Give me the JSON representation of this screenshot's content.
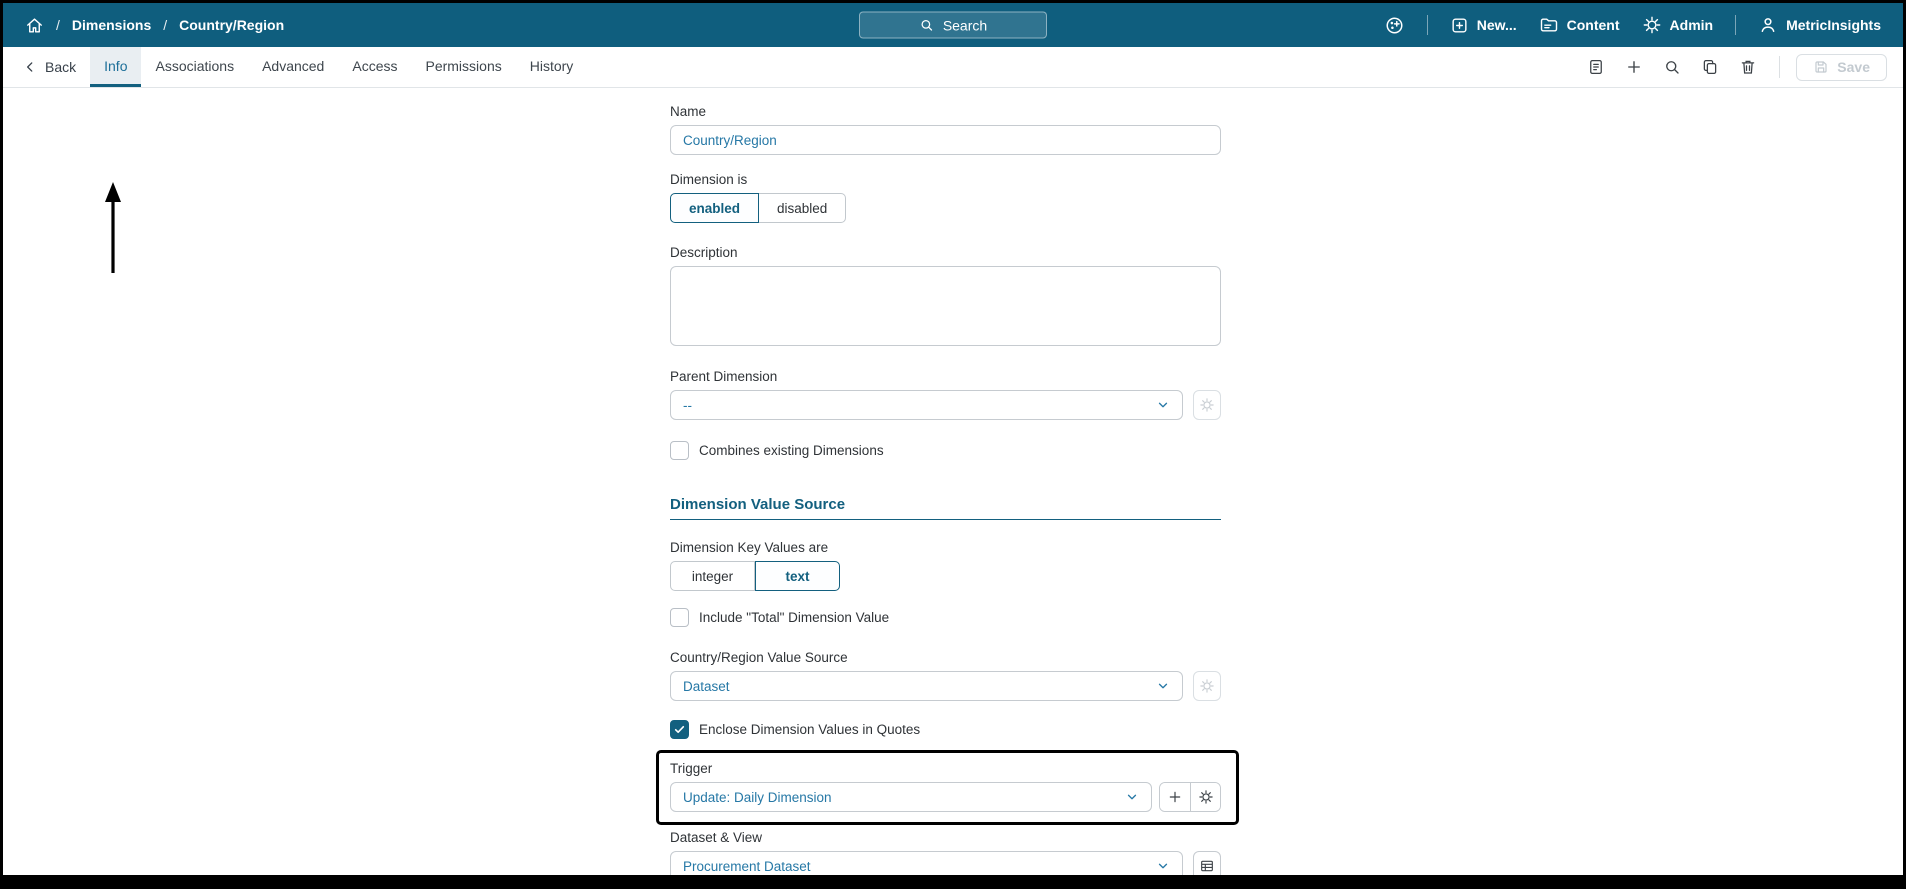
{
  "header": {
    "breadcrumb": {
      "separator": "/",
      "items": [
        "Dimensions",
        "Country/Region"
      ]
    },
    "search_placeholder": "Search",
    "nav": {
      "new_label": "New...",
      "content_label": "Content",
      "admin_label": "Admin",
      "account_label": "MetricInsights"
    }
  },
  "toolbar": {
    "back_label": "Back",
    "tabs": [
      {
        "label": "Info",
        "active": true
      },
      {
        "label": "Associations",
        "active": false
      },
      {
        "label": "Advanced",
        "active": false
      },
      {
        "label": "Access",
        "active": false
      },
      {
        "label": "Permissions",
        "active": false
      },
      {
        "label": "History",
        "active": false
      }
    ],
    "save_label": "Save"
  },
  "form": {
    "name": {
      "label": "Name",
      "value": "Country/Region"
    },
    "dimension_is": {
      "label": "Dimension is",
      "options": [
        "enabled",
        "disabled"
      ],
      "selected": "enabled"
    },
    "description": {
      "label": "Description",
      "value": ""
    },
    "parent_dimension": {
      "label": "Parent Dimension",
      "value": "--"
    },
    "combines_existing": {
      "label": "Combines existing Dimensions",
      "checked": false
    },
    "section_title": "Dimension Value Source",
    "key_values": {
      "label": "Dimension Key Values are",
      "options": [
        "integer",
        "text"
      ],
      "selected": "text"
    },
    "include_total": {
      "label": "Include \"Total\" Dimension Value",
      "checked": false
    },
    "value_source": {
      "label": "Country/Region Value Source",
      "value": "Dataset"
    },
    "enclose_quotes": {
      "label": "Enclose Dimension Values in Quotes",
      "checked": true
    },
    "trigger": {
      "label": "Trigger",
      "value": "Update: Daily Dimension"
    },
    "dataset_view": {
      "label": "Dataset & View",
      "value": "Procurement Dataset"
    }
  },
  "colors": {
    "header_bg": "#0f5e7e",
    "accent": "#13607f",
    "value_text": "#2678a6"
  }
}
